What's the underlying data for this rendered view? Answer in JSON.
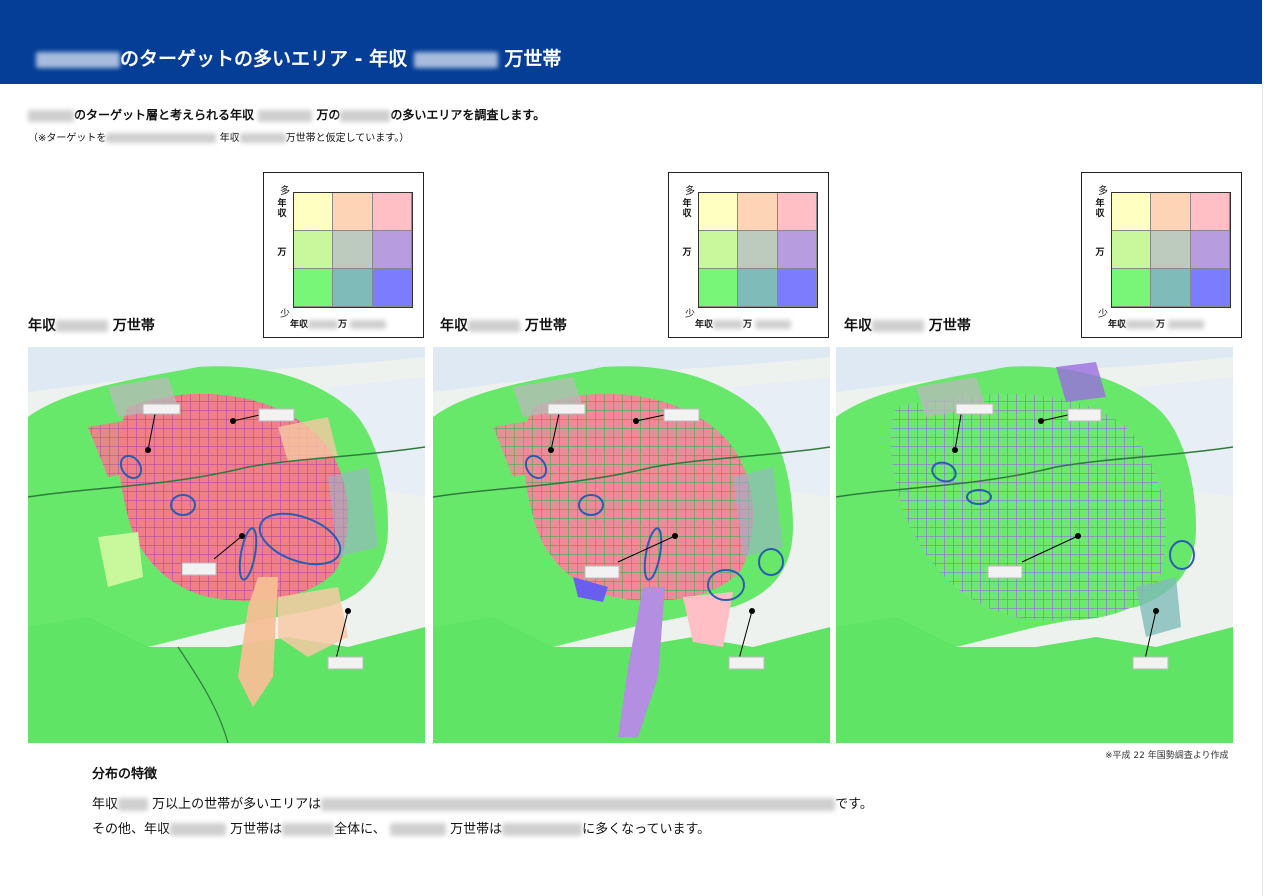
{
  "header": {
    "title_part1": "のターゲットの多いエリア - 年収",
    "title_part2": "万世帯"
  },
  "intro": {
    "text_part1": "のターゲット層と考えられる年収",
    "text_part2": "万の",
    "text_part3": "の多いエリアを調査します。",
    "note_part1": "（※ターゲットを",
    "note_part2": "年収",
    "note_part3": "万世帯と仮定しています。）"
  },
  "panels": [
    {
      "label_prefix": "年収",
      "label_suffix": "万世帯"
    },
    {
      "label_prefix": "年収",
      "label_suffix": "万世帯"
    },
    {
      "label_prefix": "年収",
      "label_suffix": "万世帯"
    }
  ],
  "legend": {
    "y_top": "多",
    "y_bottom": "少",
    "y_axis_label": "年収",
    "y_axis_mid": "万",
    "x_axis_prefix": "年収",
    "x_axis_suffix": "万",
    "cell_colors": [
      "#ffffc2",
      "#fdd5b6",
      "#ffbfc5",
      "#c8f79c",
      "#bccbbd",
      "#b89ce0",
      "#78f678",
      "#7fbcb9",
      "#7c7cff"
    ]
  },
  "source_note": "※平成 22 年国勢調査より作成",
  "features": {
    "heading": "分布の特徴",
    "line1_part1": "年収",
    "line1_part2": "万以上の世帯が多いエリアは",
    "line1_part3": "です。",
    "line2_part1": "その他、年収",
    "line2_part2": "万世帯は",
    "line2_part3": "全体に、",
    "line2_part4": "万世帯は",
    "line2_part5": "に多くなっています。"
  }
}
